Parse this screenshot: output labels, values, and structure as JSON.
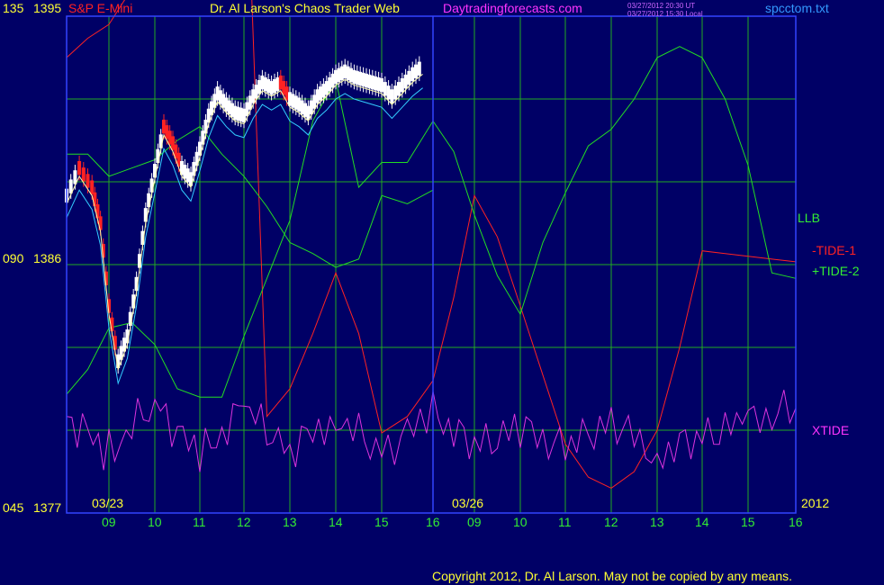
{
  "header": {
    "price_top": "135",
    "price_top2": "1395",
    "symbol": "S&P E-Mini",
    "title": "Dr. Al Larson's Chaos Trader Web",
    "website": "Daytradingforecasts.com",
    "timestamp_ut": "03/27/2012 20:30 UT",
    "timestamp_local": "03/27/2012 15:30 Local",
    "filename": "spcctom.txt"
  },
  "left_axis": {
    "mid_a": "090",
    "mid_b": "1386",
    "low_a": "045",
    "low_b": "1377"
  },
  "right_labels": {
    "llb": "LLB",
    "tide1": "-TIDE-1",
    "tide2": "+TIDE-2",
    "xtide": "XTIDE",
    "year": "2012"
  },
  "dates": {
    "d1": "03/23",
    "d2": "03/26"
  },
  "hours": [
    "09",
    "10",
    "11",
    "12",
    "13",
    "14",
    "15",
    "16",
    "09",
    "10",
    "11",
    "12",
    "13",
    "14",
    "15",
    "16"
  ],
  "copyright": "Copyright 2012, Dr. Al Larson. May not be copied by any means.",
  "colors": {
    "background": "#000066",
    "grid": "#22aa22",
    "plot_border": "#3344ff",
    "price_up": "#ffffff",
    "price_down": "#ff2222",
    "tide1": "#ff2222",
    "tide2": "#22dd22",
    "xtide": "#dd33dd",
    "llb": "#22dd22",
    "ma_fast": "#ffffaa",
    "ma_slow": "#33ccff"
  },
  "chart_data": {
    "type": "line",
    "title": "S&P E-Mini",
    "y_price_range": [
      1377,
      1395
    ],
    "y_cycle_range": [
      45,
      135
    ],
    "x_ticks": [
      "09",
      "10",
      "11",
      "12",
      "13",
      "14",
      "15",
      "16",
      "09",
      "10",
      "11",
      "12",
      "13",
      "14",
      "15",
      "16"
    ],
    "series": [
      {
        "name": "-TIDE-1",
        "x": [
          0,
          0.5,
          1,
          1.5,
          2,
          2.5,
          3,
          3.5,
          4,
          4.5,
          5,
          5.5,
          6,
          6.5,
          7,
          7.5,
          8,
          8.5,
          9,
          9.5,
          10,
          10.5,
          11,
          11.5,
          12,
          12.5,
          13,
          13.5,
          14,
          14.5,
          15,
          15.5,
          16
        ],
        "values": [
          1393.5,
          1394.2,
          1394.7,
          1396,
          1398,
          1399.5,
          1400.5,
          1402,
          1403.5,
          1380.5,
          1381.5,
          1383.5,
          1385.7,
          1383.5,
          1379.9,
          1380.5,
          1381.8,
          1384.8,
          1388.5,
          1387,
          1384.5,
          1382,
          1379.5,
          1378.3,
          1377.9,
          1378.5,
          1380,
          1383,
          1386.5,
          1386.4,
          1386.3,
          1386.2,
          1386.1
        ]
      },
      {
        "name": "+TIDE-2",
        "x": [
          0,
          0.5,
          1,
          1.5,
          2,
          2.5,
          3,
          3.5,
          4,
          4.5,
          5,
          5.5,
          6,
          6.5,
          7,
          7.5,
          8,
          8.5,
          9,
          9.5,
          10,
          10.5,
          11,
          11.5,
          12,
          12.5,
          13,
          13.5,
          14,
          14.5,
          15,
          15.5,
          16
        ],
        "values": [
          1381.3,
          1382.2,
          1383.7,
          1383.9,
          1383.1,
          1381.5,
          1381.2,
          1381.2,
          1383.4,
          1385.5,
          1387.6,
          1391.2,
          1392.7,
          1388.8,
          1389.7,
          1389.7,
          1391.2,
          1390.1,
          1387.8,
          1385.6,
          1384.2,
          1386.8,
          1388.6,
          1390.3,
          1390.9,
          1392,
          1393.5,
          1393.9,
          1393.5,
          1392,
          1389.6,
          1385.7,
          1385.5
        ]
      },
      {
        "name": "LLB",
        "x": [
          0,
          0.5,
          1,
          1.5,
          2,
          2.5,
          3,
          3.5,
          4,
          4.5,
          5,
          5.5,
          6,
          6.5,
          7,
          7.5,
          8
        ],
        "values": [
          1390,
          1390,
          1389.2,
          1389.5,
          1389.8,
          1390.5,
          1391,
          1390,
          1389.2,
          1388.1,
          1386.8,
          1386.4,
          1385.9,
          1386.2,
          1388.5,
          1388.2,
          1388.7
        ]
      },
      {
        "name": "XTIDE",
        "x": [
          0,
          1,
          2,
          3,
          4,
          5,
          6,
          7,
          8,
          9,
          10,
          11,
          12,
          13,
          14,
          15,
          16
        ],
        "values": [
          1380.5,
          1379.2,
          1381,
          1379,
          1380.8,
          1379.3,
          1380.5,
          1379.2,
          1380.6,
          1379.4,
          1380.1,
          1379.3,
          1380.4,
          1379.1,
          1379.8,
          1380.3,
          1380.8
        ]
      }
    ],
    "price_range_shown": [
      1380.5,
      1394
    ],
    "grid": true,
    "legend": "right"
  }
}
